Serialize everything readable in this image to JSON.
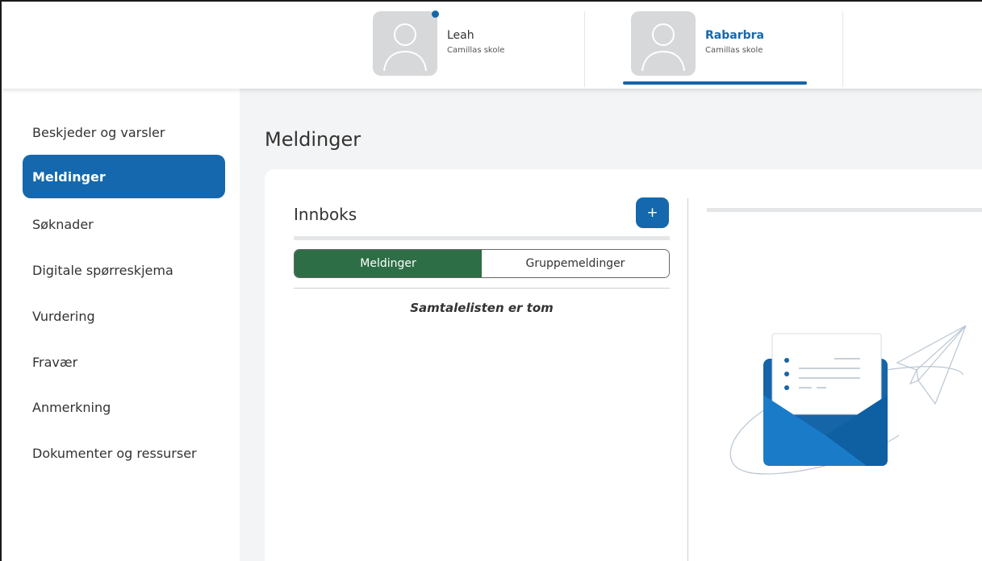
{
  "header": {
    "children": [
      {
        "name": "Leah",
        "school": "Camillas skole",
        "has_notification": true,
        "selected": false
      },
      {
        "name": "Rabarbra",
        "school": "Camillas skole",
        "has_notification": false,
        "selected": true
      }
    ]
  },
  "sidebar": {
    "items": [
      {
        "label": "Beskjeder og varsler",
        "active": false
      },
      {
        "label": "Meldinger",
        "active": true
      },
      {
        "label": "Søknader",
        "active": false
      },
      {
        "label": "Digitale spørreskjema",
        "active": false
      },
      {
        "label": "Vurdering",
        "active": false
      },
      {
        "label": "Fravær",
        "active": false
      },
      {
        "label": "Anmerkning",
        "active": false
      },
      {
        "label": "Dokumenter og ressurser",
        "active": false
      }
    ]
  },
  "main": {
    "title": "Meldinger",
    "inbox": {
      "title": "Innboks",
      "add_label": "+",
      "tabs": [
        {
          "label": "Meldinger",
          "active": true
        },
        {
          "label": "Gruppemeldinger",
          "active": false
        }
      ],
      "empty_text": "Samtalelisten er tom"
    }
  },
  "colors": {
    "accent": "#1568ad",
    "tab_active": "#2e6e46",
    "background": "#f3f4f5"
  },
  "icons": {
    "avatar": "person-silhouette-icon",
    "add": "plus-icon",
    "illustration": "envelope-paper-plane-illustration"
  }
}
